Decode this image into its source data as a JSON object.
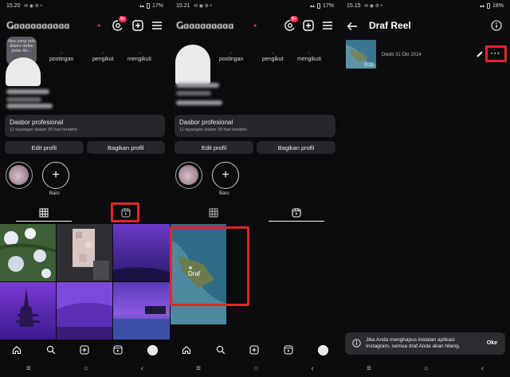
{
  "colors": {
    "background": "#0b0b0d",
    "card": "#26262b",
    "highlight_box": "#e0262b",
    "badge": "#ff2d55"
  },
  "panel1": {
    "status": {
      "time": "15.20",
      "battery": "17%"
    },
    "badge": "9+",
    "note_text": "Apa yang ada dalam daftar putar An...",
    "stats": [
      {
        "label": "postingan"
      },
      {
        "label": "pengikut"
      },
      {
        "label": "mengikuti"
      }
    ],
    "dashboard": {
      "title": "Dasbor profesional",
      "subtitle": "11 tayangan dalam 30 hari terakhir."
    },
    "buttons": {
      "edit": "Edit profil",
      "share": "Bagikan profil"
    },
    "highlight_new_label": "Baru"
  },
  "panel2": {
    "status": {
      "time": "15.21",
      "battery": "17%"
    },
    "badge": "9+",
    "stats": [
      {
        "label": "postingan"
      },
      {
        "label": "pengikut"
      },
      {
        "label": "mengikuti"
      }
    ],
    "dashboard": {
      "title": "Dasbor profesional",
      "subtitle": "11 tayangan dalam 30 hari terakhir."
    },
    "buttons": {
      "edit": "Edit profil",
      "share": "Bagikan profil"
    },
    "highlight_new_label": "Baru",
    "draft_label": "Draf"
  },
  "panel3": {
    "status": {
      "time": "15.15",
      "battery": "18%"
    },
    "title": "Draf Reel",
    "draft": {
      "date": "Diedit 31 Okt 2024",
      "duration": "0:22"
    },
    "toast": {
      "message": "Jika Anda menghapus instalan aplikasi Instagram, semua draf Anda akan hilang.",
      "action": "Oke"
    }
  },
  "icons": [
    "threads-icon",
    "add-icon",
    "menu-icon",
    "grid-icon",
    "reels-icon",
    "home-icon",
    "search-icon",
    "create-icon",
    "profile-icon",
    "back-icon",
    "info-icon",
    "edit-icon",
    "more-icon"
  ]
}
